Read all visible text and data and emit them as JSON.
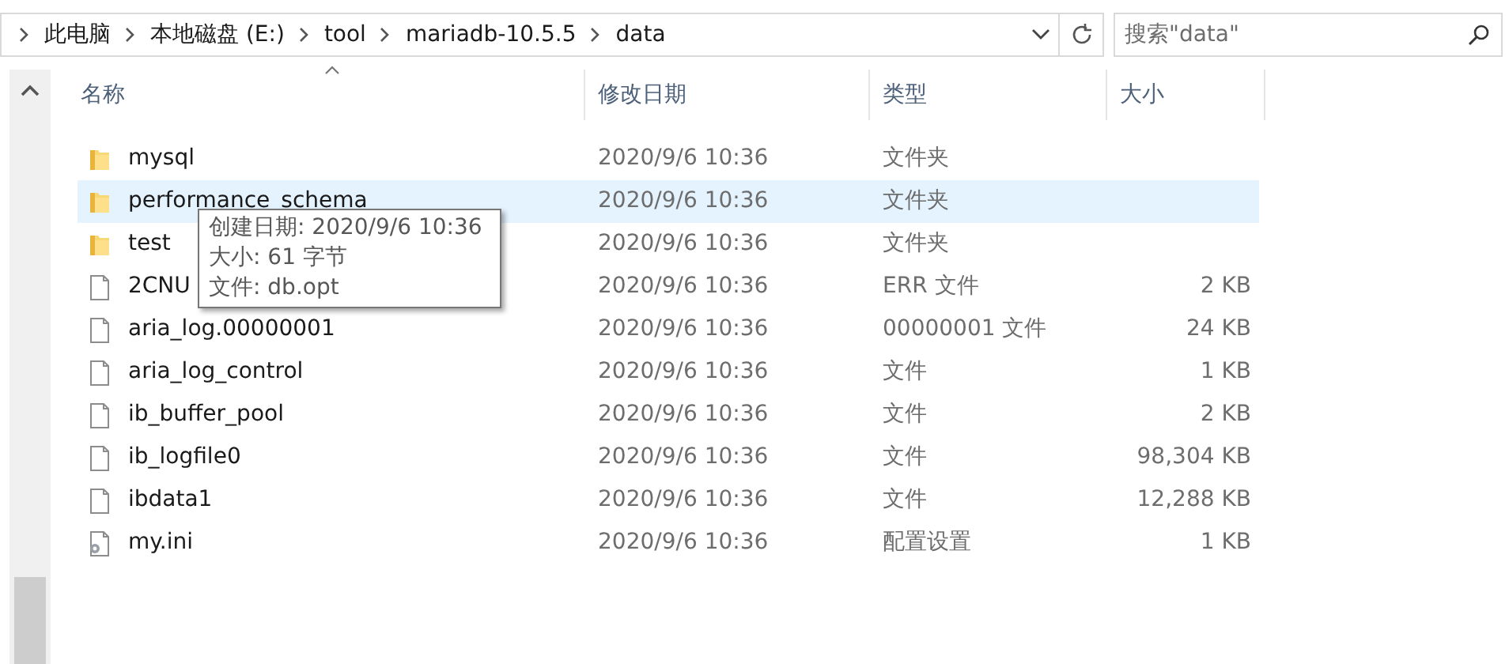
{
  "address_bar": {
    "crumbs": [
      "此电脑",
      "本地磁盘 (E:)",
      "tool",
      "mariadb-10.5.5",
      "data"
    ]
  },
  "search": {
    "placeholder": "搜索\"data\""
  },
  "columns": [
    {
      "label": "名称",
      "sorted": true
    },
    {
      "label": "修改日期",
      "sorted": false
    },
    {
      "label": "类型",
      "sorted": false
    },
    {
      "label": "大小",
      "sorted": false
    }
  ],
  "rows": [
    {
      "kind": "folder",
      "name": "mysql",
      "date": "2020/9/6 10:36",
      "type": "文件夹",
      "hovered": false
    },
    {
      "kind": "folder",
      "name": "performance_schema",
      "date": "2020/9/6 10:36",
      "type": "文件夹",
      "hovered": true
    },
    {
      "kind": "folder",
      "name": "test",
      "date": "2020/9/6 10:36",
      "type": "文件夹",
      "hovered": false
    },
    {
      "kind": "file",
      "name": "2CNU",
      "date": "2020/9/6 10:36",
      "type": "ERR 文件",
      "size": "2 KB",
      "hovered": false
    },
    {
      "kind": "file",
      "name": "aria_log.00000001",
      "date": "2020/9/6 10:36",
      "type": "00000001 文件",
      "size": "24 KB",
      "hovered": false
    },
    {
      "kind": "file",
      "name": "aria_log_control",
      "date": "2020/9/6 10:36",
      "type": "文件",
      "size": "1 KB",
      "hovered": false
    },
    {
      "kind": "file",
      "name": "ib_buffer_pool",
      "date": "2020/9/6 10:36",
      "type": "文件",
      "size": "2 KB",
      "hovered": false
    },
    {
      "kind": "file",
      "name": "ib_logfile0",
      "date": "2020/9/6 10:36",
      "type": "文件",
      "size": "98,304 KB",
      "hovered": false
    },
    {
      "kind": "file",
      "name": "ibdata1",
      "date": "2020/9/6 10:36",
      "type": "文件",
      "size": "12,288 KB",
      "hovered": false
    },
    {
      "kind": "config",
      "name": "my.ini",
      "date": "2020/9/6 10:36",
      "type": "配置设置",
      "size": "1 KB",
      "hovered": false
    }
  ],
  "tooltip": {
    "lines": [
      "创建日期: 2020/9/6 10:36",
      "大小: 61 字节",
      "文件: db.opt"
    ]
  }
}
